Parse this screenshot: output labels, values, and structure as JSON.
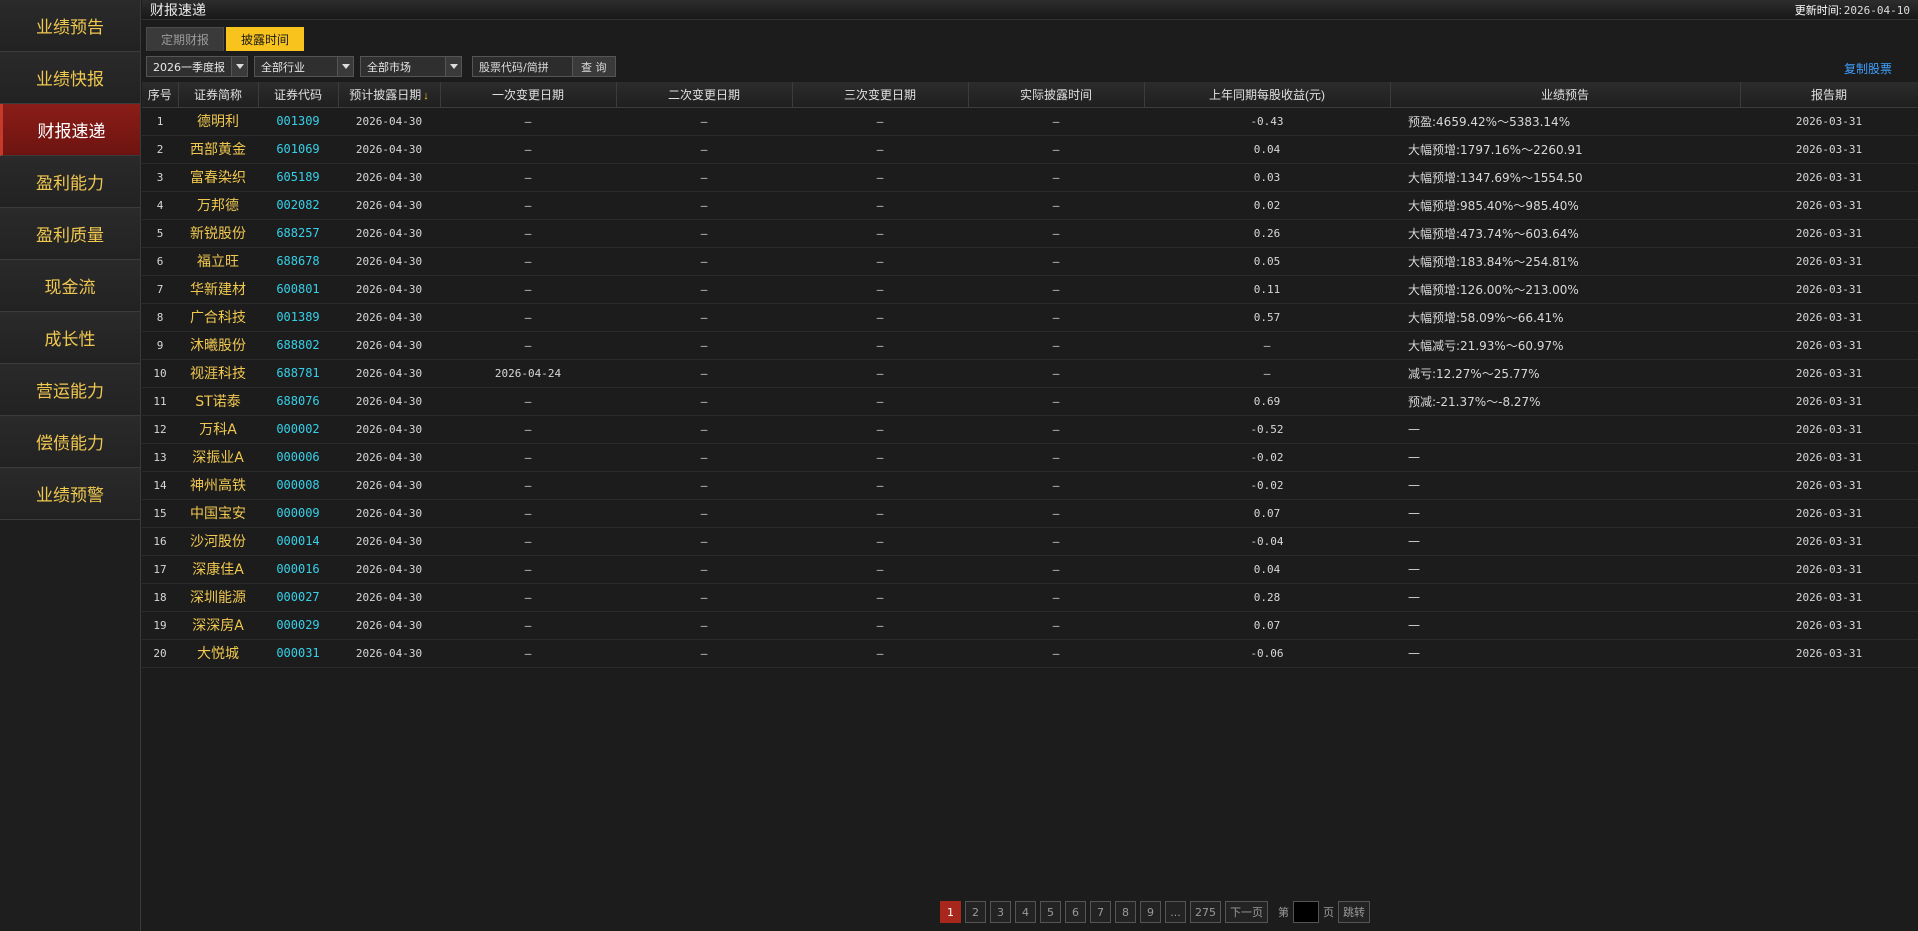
{
  "sidebar": {
    "items": [
      {
        "label": "业绩预告",
        "active": false
      },
      {
        "label": "业绩快报",
        "active": false
      },
      {
        "label": "财报速递",
        "active": true
      },
      {
        "label": "盈利能力",
        "active": false
      },
      {
        "label": "盈利质量",
        "active": false
      },
      {
        "label": "现金流",
        "active": false
      },
      {
        "label": "成长性",
        "active": false
      },
      {
        "label": "营运能力",
        "active": false
      },
      {
        "label": "偿债能力",
        "active": false
      },
      {
        "label": "业绩预警",
        "active": false
      }
    ]
  },
  "header": {
    "title": "财报速递",
    "update_label": "更新时间:",
    "update_value": "2026-04-10"
  },
  "tabs": [
    {
      "label": "定期财报",
      "active": false
    },
    {
      "label": "披露时间",
      "active": true
    }
  ],
  "filters": {
    "period": "2026一季度报",
    "industry": "全部行业",
    "market": "全部市场",
    "search_placeholder": "股票代码/简拼",
    "search_button": "查 询",
    "copy_label": "复制股票"
  },
  "table": {
    "columns": [
      "序号",
      "证券简称",
      "证券代码",
      "预计披露日期",
      "一次变更日期",
      "二次变更日期",
      "三次变更日期",
      "实际披露时间",
      "上年同期每股收益(元)",
      "业绩预告",
      "报告期"
    ],
    "sort_icon": "↓",
    "rows": [
      [
        "1",
        "德明利",
        "001309",
        "2026-04-30",
        "—",
        "—",
        "—",
        "—",
        "-0.43",
        "预盈:4659.42%～5383.14%",
        "2026-03-31"
      ],
      [
        "2",
        "西部黄金",
        "601069",
        "2026-04-30",
        "—",
        "—",
        "—",
        "—",
        "0.04",
        "大幅预增:1797.16%～2260.91",
        "2026-03-31"
      ],
      [
        "3",
        "富春染织",
        "605189",
        "2026-04-30",
        "—",
        "—",
        "—",
        "—",
        "0.03",
        "大幅预增:1347.69%～1554.50",
        "2026-03-31"
      ],
      [
        "4",
        "万邦德",
        "002082",
        "2026-04-30",
        "—",
        "—",
        "—",
        "—",
        "0.02",
        "大幅预增:985.40%～985.40%",
        "2026-03-31"
      ],
      [
        "5",
        "新锐股份",
        "688257",
        "2026-04-30",
        "—",
        "—",
        "—",
        "—",
        "0.26",
        "大幅预增:473.74%～603.64%",
        "2026-03-31"
      ],
      [
        "6",
        "福立旺",
        "688678",
        "2026-04-30",
        "—",
        "—",
        "—",
        "—",
        "0.05",
        "大幅预增:183.84%～254.81%",
        "2026-03-31"
      ],
      [
        "7",
        "华新建材",
        "600801",
        "2026-04-30",
        "—",
        "—",
        "—",
        "—",
        "0.11",
        "大幅预增:126.00%～213.00%",
        "2026-03-31"
      ],
      [
        "8",
        "广合科技",
        "001389",
        "2026-04-30",
        "—",
        "—",
        "—",
        "—",
        "0.57",
        "大幅预增:58.09%～66.41%",
        "2026-03-31"
      ],
      [
        "9",
        "沐曦股份",
        "688802",
        "2026-04-30",
        "—",
        "—",
        "—",
        "—",
        "—",
        "大幅减亏:21.93%～60.97%",
        "2026-03-31"
      ],
      [
        "10",
        "视涯科技",
        "688781",
        "2026-04-30",
        "2026-04-24",
        "—",
        "—",
        "—",
        "—",
        "减亏:12.27%～25.77%",
        "2026-03-31"
      ],
      [
        "11",
        "ST诺泰",
        "688076",
        "2026-04-30",
        "—",
        "—",
        "—",
        "—",
        "0.69",
        "预减:-21.37%～-8.27%",
        "2026-03-31"
      ],
      [
        "12",
        "万科A",
        "000002",
        "2026-04-30",
        "—",
        "—",
        "—",
        "—",
        "-0.52",
        "—",
        "2026-03-31"
      ],
      [
        "13",
        "深振业A",
        "000006",
        "2026-04-30",
        "—",
        "—",
        "—",
        "—",
        "-0.02",
        "—",
        "2026-03-31"
      ],
      [
        "14",
        "神州高铁",
        "000008",
        "2026-04-30",
        "—",
        "—",
        "—",
        "—",
        "-0.02",
        "—",
        "2026-03-31"
      ],
      [
        "15",
        "中国宝安",
        "000009",
        "2026-04-30",
        "—",
        "—",
        "—",
        "—",
        "0.07",
        "—",
        "2026-03-31"
      ],
      [
        "16",
        "沙河股份",
        "000014",
        "2026-04-30",
        "—",
        "—",
        "—",
        "—",
        "-0.04",
        "—",
        "2026-03-31"
      ],
      [
        "17",
        "深康佳A",
        "000016",
        "2026-04-30",
        "—",
        "—",
        "—",
        "—",
        "0.04",
        "—",
        "2026-03-31"
      ],
      [
        "18",
        "深圳能源",
        "000027",
        "2026-04-30",
        "—",
        "—",
        "—",
        "—",
        "0.28",
        "—",
        "2026-03-31"
      ],
      [
        "19",
        "深深房A",
        "000029",
        "2026-04-30",
        "—",
        "—",
        "—",
        "—",
        "0.07",
        "—",
        "2026-03-31"
      ],
      [
        "20",
        "大悦城",
        "000031",
        "2026-04-30",
        "—",
        "—",
        "—",
        "—",
        "-0.06",
        "—",
        "2026-03-31"
      ]
    ]
  },
  "pager": {
    "pages": [
      "1",
      "2",
      "3",
      "4",
      "5",
      "6",
      "7",
      "8",
      "9",
      "...",
      "275"
    ],
    "current": "1",
    "next_label": "下一页",
    "goto_prefix": "第",
    "goto_suffix": "页",
    "goto_button": "跳转"
  },
  "colors": {
    "accent": "#f7c31c",
    "active_sidebar": "#8a1d18",
    "stock_name": "#f0c850",
    "stock_code": "#37d0e8",
    "link": "#3f9fff"
  }
}
